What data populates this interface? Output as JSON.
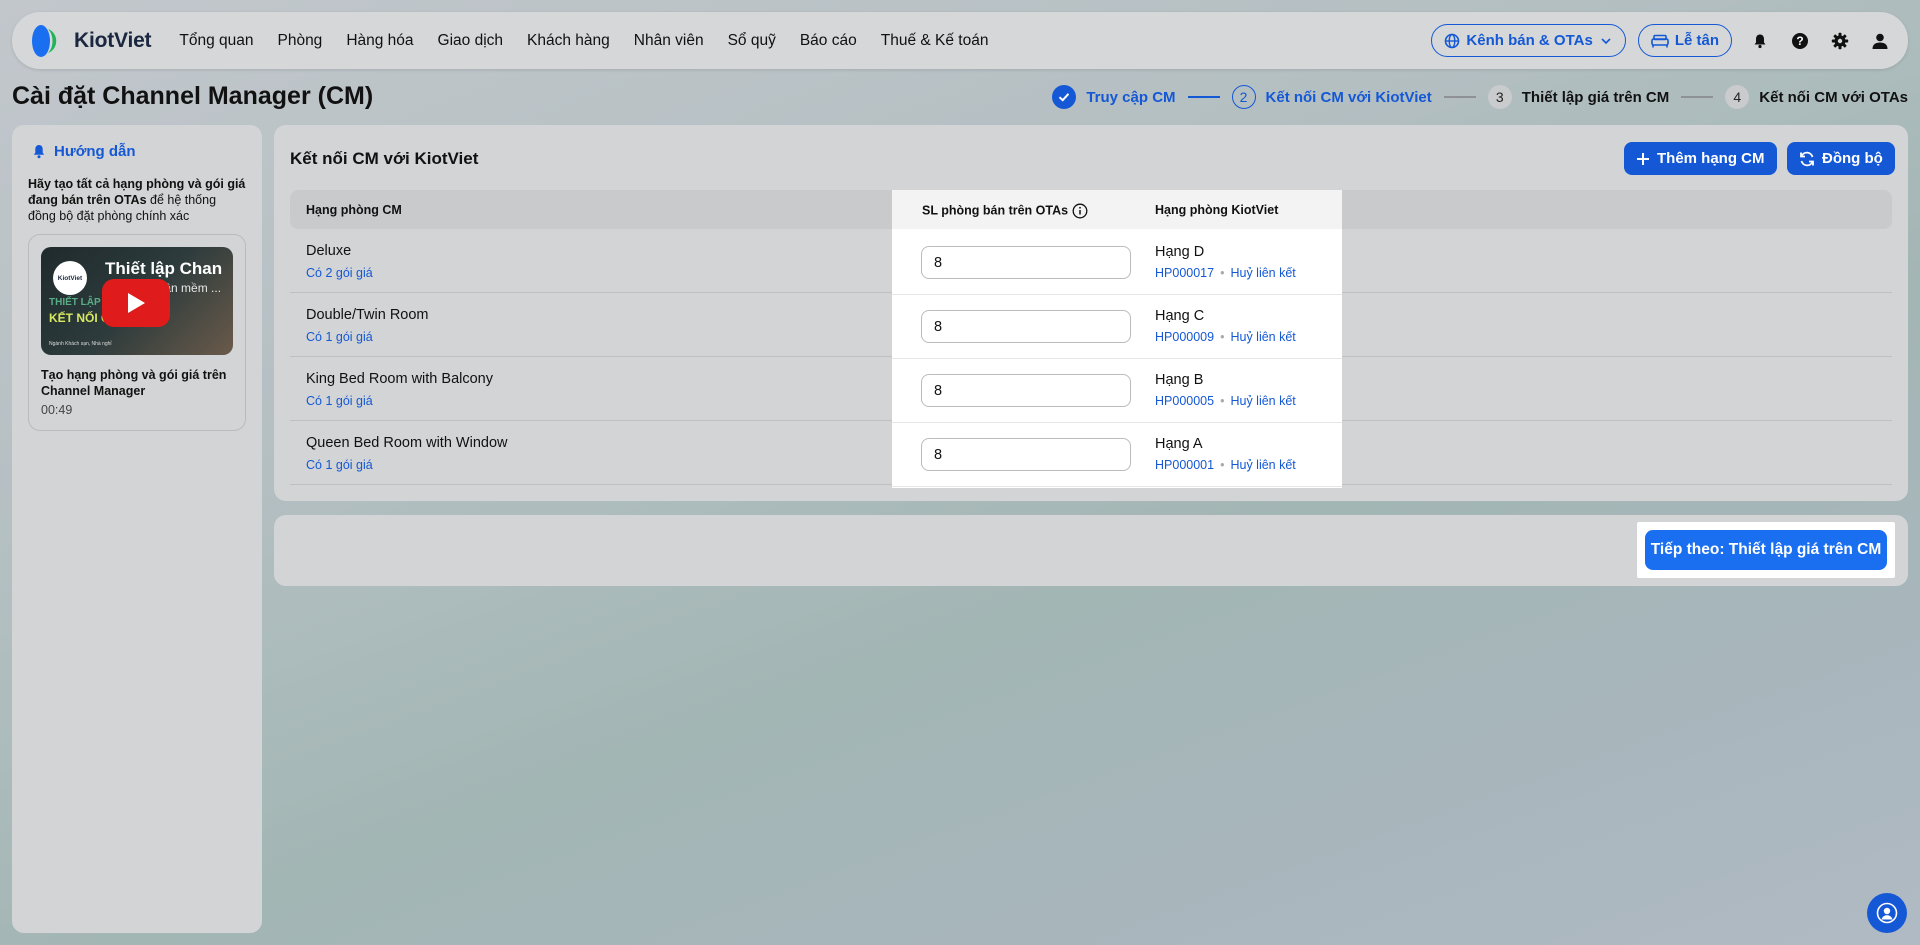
{
  "brand": {
    "name": "KiotViet"
  },
  "nav": {
    "items": [
      "Tổng quan",
      "Phòng",
      "Hàng hóa",
      "Giao dịch",
      "Khách hàng",
      "Nhân viên",
      "Sổ quỹ",
      "Báo cáo",
      "Thuế & Kế toán"
    ]
  },
  "topbar": {
    "channels_label": "Kênh bán & OTAs",
    "reception_label": "Lễ tân"
  },
  "page": {
    "title": "Cài đặt Channel Manager (CM)"
  },
  "stepper": {
    "steps": [
      {
        "number": "1",
        "label": "Truy cập CM",
        "state": "done"
      },
      {
        "number": "2",
        "label": "Kết nối CM với KiotViet",
        "state": "active"
      },
      {
        "number": "3",
        "label": "Thiết lập giá trên CM",
        "state": "todo"
      },
      {
        "number": "4",
        "label": "Kết nối CM với OTAs",
        "state": "todo"
      }
    ]
  },
  "guide": {
    "title": "Hướng dẫn",
    "text_bold": "Hãy tạo tất cả hạng phòng và gói giá đang bán trên OTAs",
    "text_rest": " để hệ thống đồng bộ đặt phòng chính xác",
    "video": {
      "thumb_title": "Thiết lập Chan",
      "thumb_sub": "HDSD - Phần mềm ...",
      "thumb_avatar": "KiotViet",
      "thumb_overlay_1": "THIẾT LẬP",
      "thumb_overlay_2": "KẾT NỐI C",
      "thumb_overlay_3": "Ngành Khách sạn, Nhà nghỉ",
      "title": "Tạo hạng phòng và gói giá trên Channel Manager",
      "duration": "00:49"
    }
  },
  "card": {
    "title": "Kết nối CM với KiotViet",
    "add_button": "Thêm hạng CM",
    "sync_button": "Đồng bộ"
  },
  "table": {
    "headers": {
      "cm_room": "Hạng phòng CM",
      "ota_qty": "SL phòng bán trên OTAs",
      "kv_room": "Hạng phòng KiotViet"
    },
    "unlink_label": "Huỷ liên kết",
    "rows": [
      {
        "name": "Deluxe",
        "packages": "Có 2 gói giá",
        "qty": "8",
        "kv_name": "Hạng D",
        "kv_code": "HP000017"
      },
      {
        "name": "Double/Twin Room",
        "packages": "Có 1 gói giá",
        "qty": "8",
        "kv_name": "Hạng C",
        "kv_code": "HP000009"
      },
      {
        "name": "King Bed Room with Balcony",
        "packages": "Có 1 gói giá",
        "qty": "8",
        "kv_name": "Hạng B",
        "kv_code": "HP000005"
      },
      {
        "name": "Queen Bed Room with Window",
        "packages": "Có 1 gói giá",
        "qty": "8",
        "kv_name": "Hạng A",
        "kv_code": "HP000001"
      }
    ]
  },
  "footer": {
    "next_button": "Tiếp theo: Thiết lập giá trên CM"
  },
  "colors": {
    "accent": "#1458d6",
    "next_button": "#1a6ff0",
    "video_play": "#e01b1b"
  }
}
